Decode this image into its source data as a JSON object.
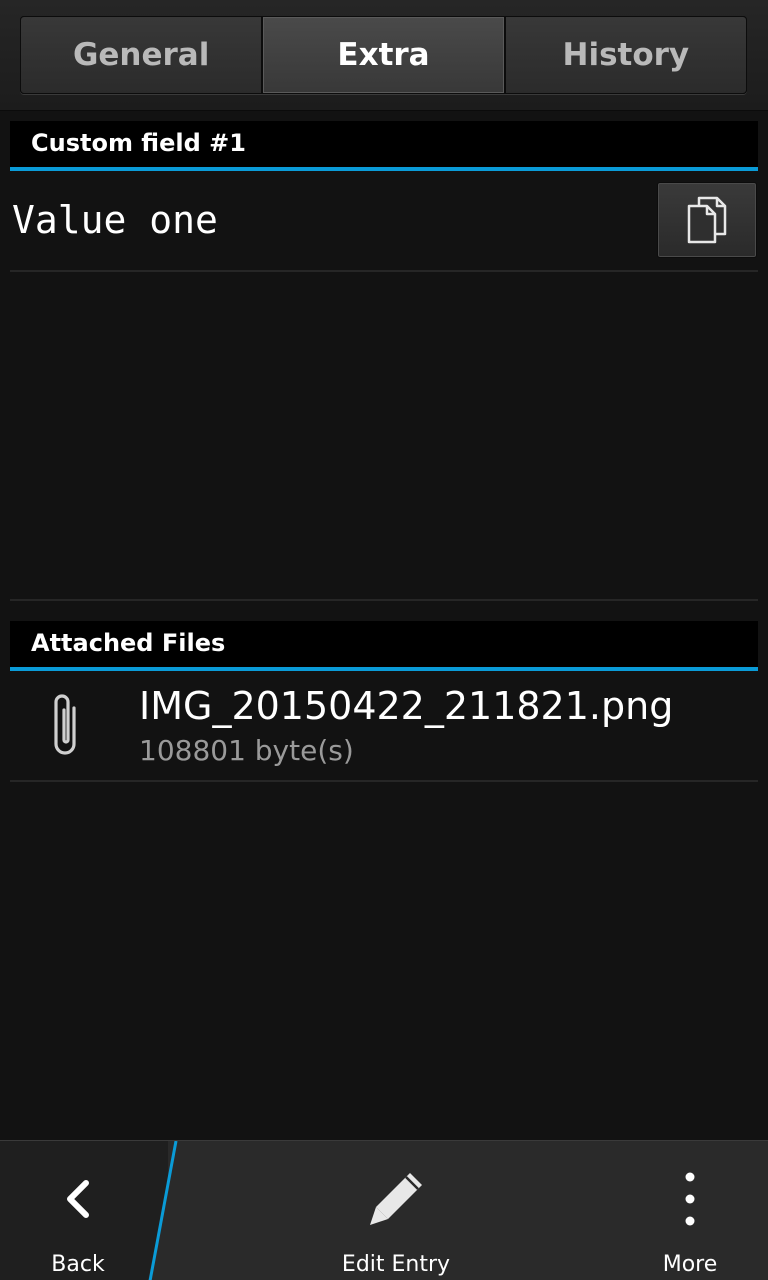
{
  "tabs": [
    {
      "label": "General",
      "active": false
    },
    {
      "label": "Extra",
      "active": true
    },
    {
      "label": "History",
      "active": false
    }
  ],
  "custom_fields": {
    "header": "Custom field #1",
    "value": "Value one",
    "copy_icon": "copy-icon"
  },
  "attachments": {
    "header": "Attached Files",
    "items": [
      {
        "name": "IMG_20150422_211821.png",
        "size": "108801 byte(s)",
        "icon": "paperclip-icon"
      }
    ]
  },
  "action_bar": {
    "back_label": "Back",
    "edit_label": "Edit Entry",
    "more_label": "More"
  },
  "colors": {
    "accent": "#0a9bd7",
    "background": "#121212",
    "header_bg": "#000000",
    "action_bar_bg": "#2a2a2a"
  }
}
